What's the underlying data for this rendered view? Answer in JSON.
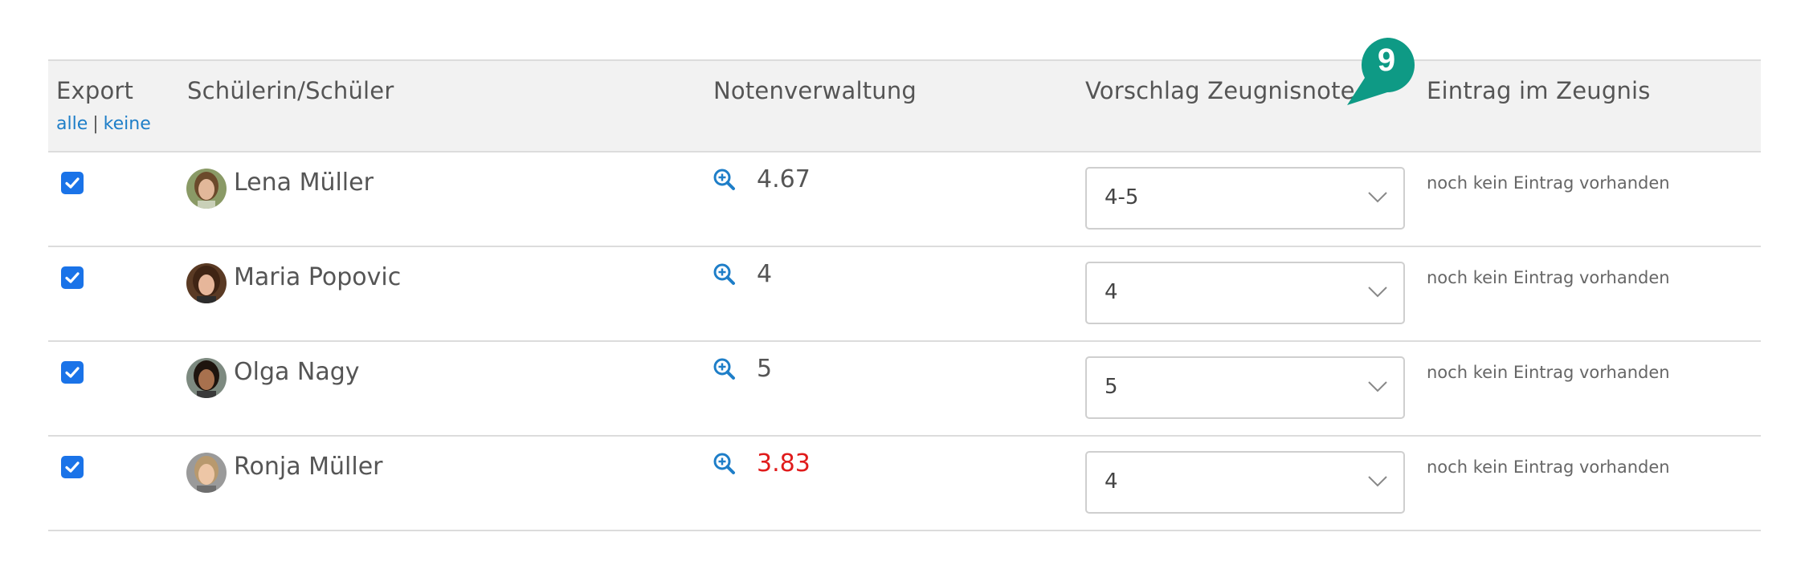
{
  "header": {
    "export": "Export",
    "export_all": "alle",
    "export_separator": "|",
    "export_none": "keine",
    "student": "Schülerin/Schüler",
    "grade_admin": "Notenverwaltung",
    "suggestion": "Vorschlag Zeugnisnote",
    "report_entry": "Eintrag im Zeugnis",
    "badge": "9"
  },
  "colors": {
    "accent": "#1e7ec8",
    "checkbox": "#1a73e8",
    "badge": "#0e9a85",
    "warning": "#e01b1b"
  },
  "icons": {
    "grade_detail": "zoom-in-icon",
    "select": "chevron-down-icon",
    "checkbox": "check-icon"
  },
  "rows": [
    {
      "export_checked": true,
      "name": "Lena Müller",
      "grade": "4.67",
      "grade_warning": false,
      "suggestion": "4-5",
      "entry": "noch kein Eintrag vorhanden"
    },
    {
      "export_checked": true,
      "name": "Maria Popovic",
      "grade": "4",
      "grade_warning": false,
      "suggestion": "4",
      "entry": "noch kein Eintrag vorhanden"
    },
    {
      "export_checked": true,
      "name": "Olga Nagy",
      "grade": "5",
      "grade_warning": false,
      "suggestion": "5",
      "entry": "noch kein Eintrag vorhanden"
    },
    {
      "export_checked": true,
      "name": "Ronja Müller",
      "grade": "3.83",
      "grade_warning": true,
      "suggestion": "4",
      "entry": "noch kein Eintrag vorhanden"
    }
  ]
}
